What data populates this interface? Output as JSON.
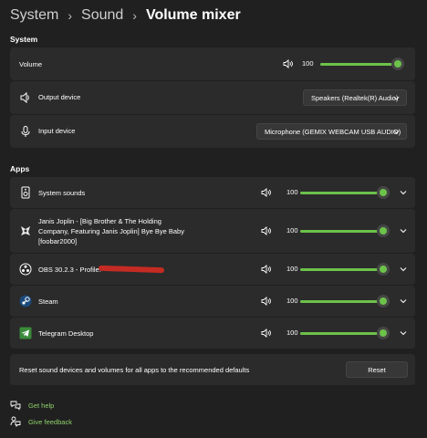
{
  "breadcrumb": {
    "part1": "System",
    "part2": "Sound",
    "part3": "Volume mixer"
  },
  "sections": {
    "system": "System",
    "apps": "Apps"
  },
  "system": {
    "volume_label": "Volume",
    "volume_value": "100",
    "volume_level": 1.0,
    "output_label": "Output device",
    "output_value": "Speakers (Realtek(R) Audio)",
    "input_label": "Input device",
    "input_value": "Microphone (GEMIX WEBCAM USB AUDIO)"
  },
  "apps": [
    {
      "name": "System sounds",
      "value": "100",
      "level": 1.0,
      "icon": "system-sounds-icon"
    },
    {
      "name": "Janis Joplin - [Big Brother & The Holding Company, Featuring Janis Joplin] Bye Bye Baby  [foobar2000]",
      "value": "100",
      "level": 1.0,
      "icon": "foobar-icon"
    },
    {
      "name": "OBS 30.2.3 - Profile:",
      "value": "100",
      "level": 1.0,
      "icon": "obs-icon"
    },
    {
      "name": "Steam",
      "value": "100",
      "level": 1.0,
      "icon": "steam-icon"
    },
    {
      "name": "Telegram Desktop",
      "value": "100",
      "level": 1.0,
      "icon": "telegram-icon"
    }
  ],
  "reset": {
    "label": "Reset sound devices and volumes for all apps to the recommended defaults",
    "button": "Reset"
  },
  "links": {
    "help": "Get help",
    "feedback": "Give feedback"
  },
  "colors": {
    "accent": "#6cc24a",
    "link": "#8fd16b",
    "background": "#202020",
    "card": "#2b2b2b"
  }
}
